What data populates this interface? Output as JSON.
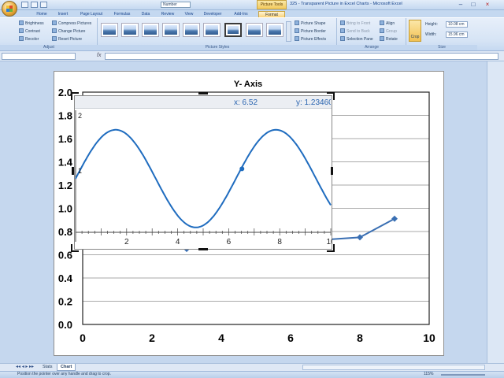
{
  "window": {
    "title": "325 - Transparent Picture in Excel Charts - Microsoft Excel",
    "qat_combo": "Number",
    "tools_tab": "Picture Tools"
  },
  "tabs": [
    "Home",
    "Insert",
    "Page Layout",
    "Formulas",
    "Data",
    "Review",
    "View",
    "Developer",
    "Add-Ins",
    "Format"
  ],
  "ribbon": {
    "adjust": {
      "label": "Adjust",
      "items": [
        "Brightness",
        "Contrast",
        "Recolor",
        "Compress Pictures",
        "Change Picture",
        "Reset Picture"
      ]
    },
    "picture_styles": {
      "label": "Picture Styles",
      "items": [
        "Picture Shape",
        "Picture Border",
        "Picture Effects"
      ]
    },
    "arrange": {
      "label": "Arrange",
      "items": [
        "Bring to Front",
        "Send to Back",
        "Selection Pane",
        "Align",
        "Group",
        "Rotate"
      ]
    },
    "size": {
      "label": "Size",
      "crop": "Crop",
      "height_label": "Height:",
      "height_value": "10.08 cm",
      "width_label": "Width:",
      "width_value": "15.96 cm"
    }
  },
  "formula_bar": {
    "fx": "fx"
  },
  "overlay": {
    "x_readout": "x: 6.52",
    "y_readout": "y: 1.23460",
    "x_ticks": [
      "2",
      "4",
      "6",
      "8",
      "10"
    ],
    "y_ticks": [
      "2",
      "1"
    ]
  },
  "sheet_tabs": [
    "Stats",
    "Chart"
  ],
  "status": {
    "text": "Position the pointer over any handle and drag to crop.",
    "zoom": "115%"
  },
  "chart_data": [
    {
      "type": "line",
      "title": "Y- Axis",
      "x": [
        0,
        3,
        8,
        9
      ],
      "series": [
        {
          "values": [
            1.2,
            0.65,
            0.75,
            0.91
          ]
        }
      ],
      "xlim": [
        0,
        10
      ],
      "ylim": [
        0.0,
        2.0
      ],
      "xticks": [
        "0",
        "2",
        "4",
        "6",
        "8",
        "10"
      ],
      "yticks": [
        "0.0",
        "0.2",
        "0.4",
        "0.6",
        "0.8",
        "1.0",
        "1.2",
        "1.4",
        "1.6",
        "1.8",
        "2.0"
      ],
      "grid": true,
      "color": "#3a6fb3"
    },
    {
      "type": "line",
      "function": "y = 1.3 + 0.5*sin(x)",
      "xlim": [
        0,
        10
      ],
      "ylim": [
        0.75,
        2.0
      ],
      "highlight_point": {
        "x": 6.52,
        "y": 1.4
      },
      "color": "#1f6cbf"
    }
  ]
}
